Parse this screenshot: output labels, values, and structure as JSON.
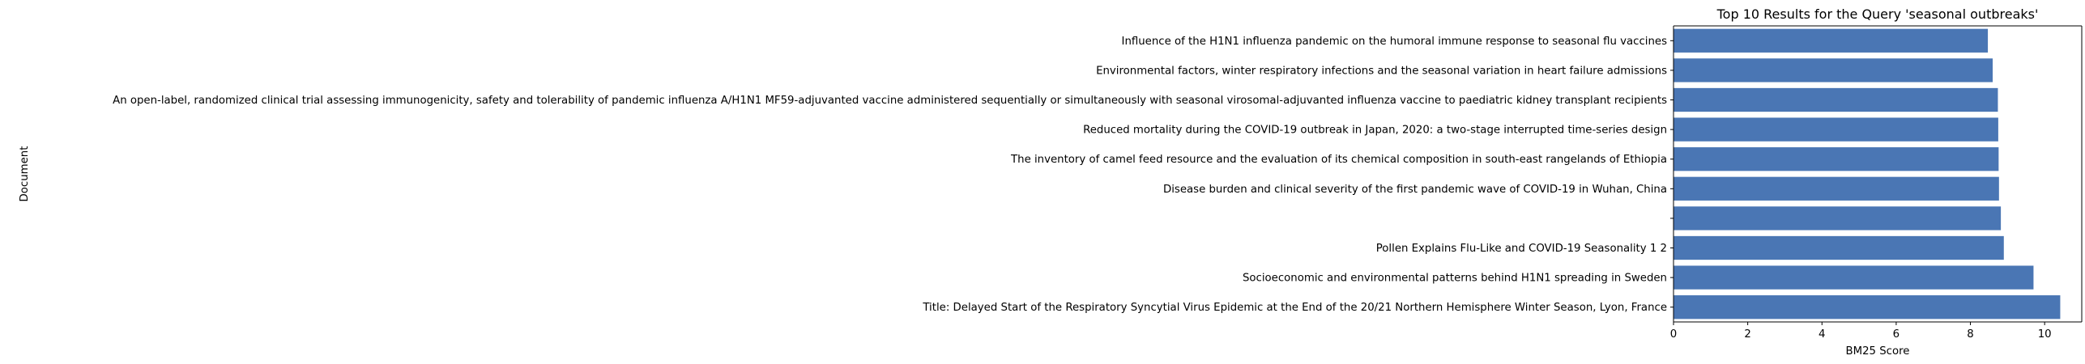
{
  "chart_data": {
    "type": "bar",
    "orientation": "horizontal",
    "title": "Top 10 Results for the Query 'seasonal outbreaks'",
    "xlabel": "BM25 Score",
    "ylabel": "Document",
    "xlim": [
      0,
      11
    ],
    "xticks": [
      0,
      2,
      4,
      6,
      8,
      10
    ],
    "grid": false,
    "bar_color": "#4a76b4",
    "categories": [
      "Title: Delayed Start of the Respiratory Syncytial Virus Epidemic at the End of the 20/21 Northern Hemisphere Winter Season, Lyon, France",
      "Socioeconomic and environmental patterns behind H1N1 spreading in Sweden",
      "Pollen Explains Flu-Like and COVID-19 Seasonality 1 2",
      "",
      "Disease burden and clinical severity of the first pandemic wave of COVID-19 in Wuhan, China",
      "The inventory of camel feed resource and the evaluation of its chemical composition in south-east rangelands of Ethiopia",
      "Reduced mortality during the COVID-19 outbreak in Japan, 2020: a two-stage interrupted time-series design",
      "An open-label, randomized clinical trial assessing immunogenicity, safety and tolerability of pandemic influenza A/H1N1 MF59-adjuvanted vaccine administered sequentially or simultaneously with seasonal virosomal-adjuvanted influenza vaccine to paediatric kidney transplant recipients",
      "Environmental factors, winter respiratory infections and the seasonal variation in heart failure admissions",
      "Influence of the H1N1 influenza pandemic on the humoral immune response to seasonal flu vaccines"
    ],
    "values": [
      10.42,
      9.7,
      8.9,
      8.82,
      8.77,
      8.76,
      8.75,
      8.74,
      8.6,
      8.47
    ]
  }
}
